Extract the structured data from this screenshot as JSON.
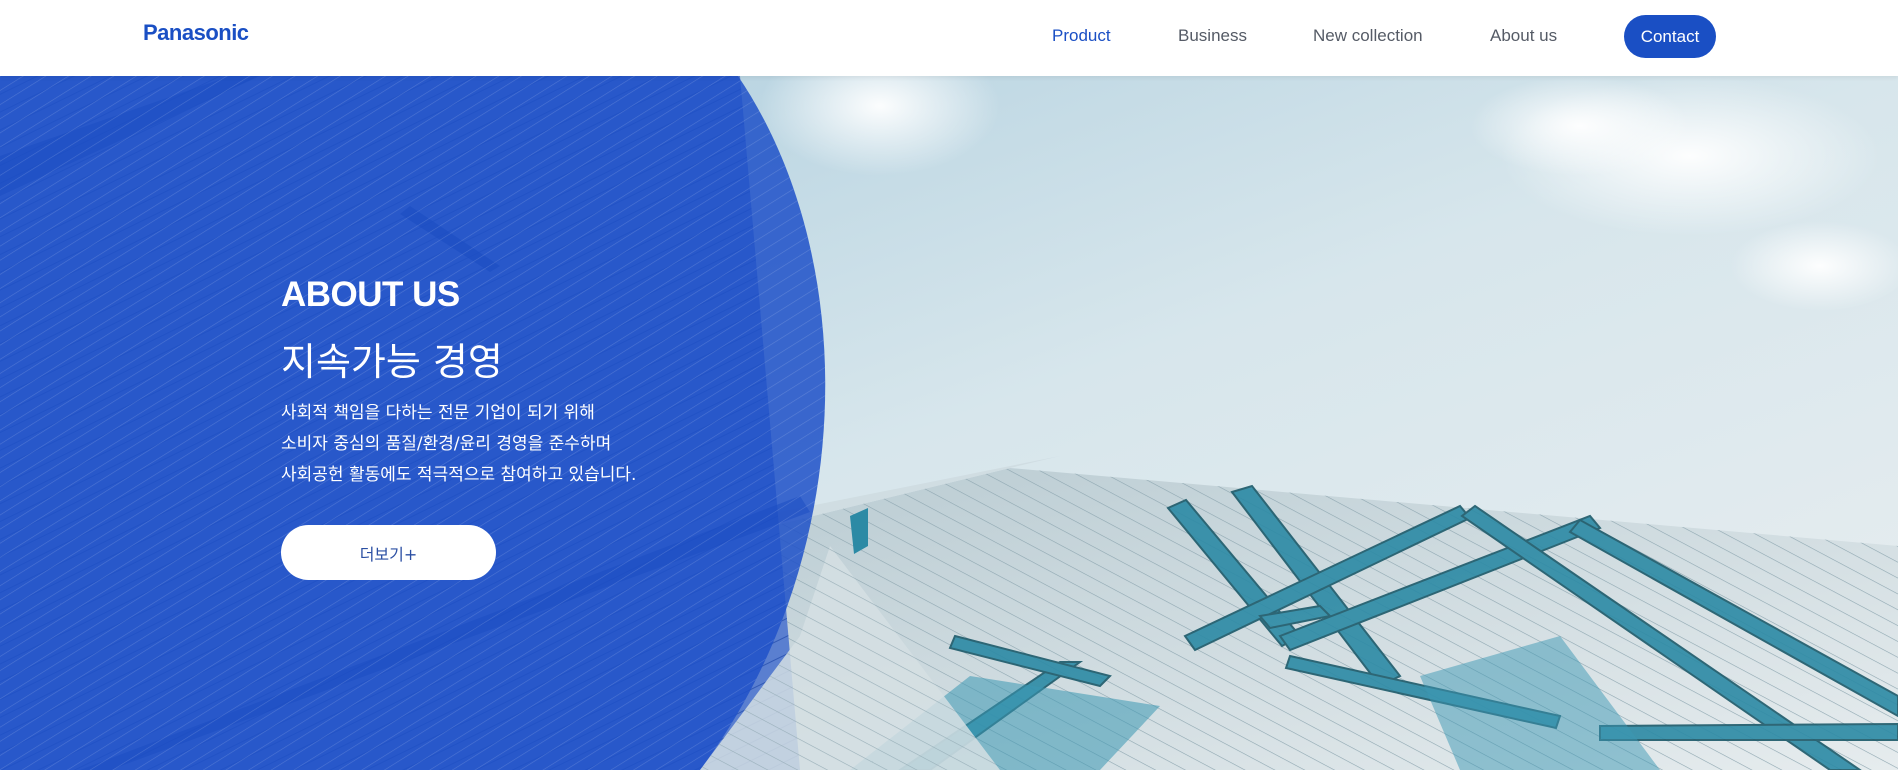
{
  "header": {
    "logo_text": "Panasonic",
    "nav": {
      "product": "Product",
      "business": "Business",
      "new_collection": "New collection",
      "about_us": "About us"
    },
    "contact_label": "Contact"
  },
  "hero": {
    "title": "ABOUT US",
    "subtitle": "지속가능 경영",
    "description_lines": [
      "사회적 책임을 다하는 전문 기업이 되기 위해",
      "소비자 중심의 품질/환경/윤리 경영을 준수하며",
      "사회공헌 활동에도 적극적으로 참여하고 있습니다."
    ],
    "more_button_label": "더보기+"
  },
  "colors": {
    "brand_blue": "#1a4fc4",
    "overlay_blue": "#1f52c8",
    "sky": "#cfe0e8",
    "glass": "#2f8aa6"
  }
}
